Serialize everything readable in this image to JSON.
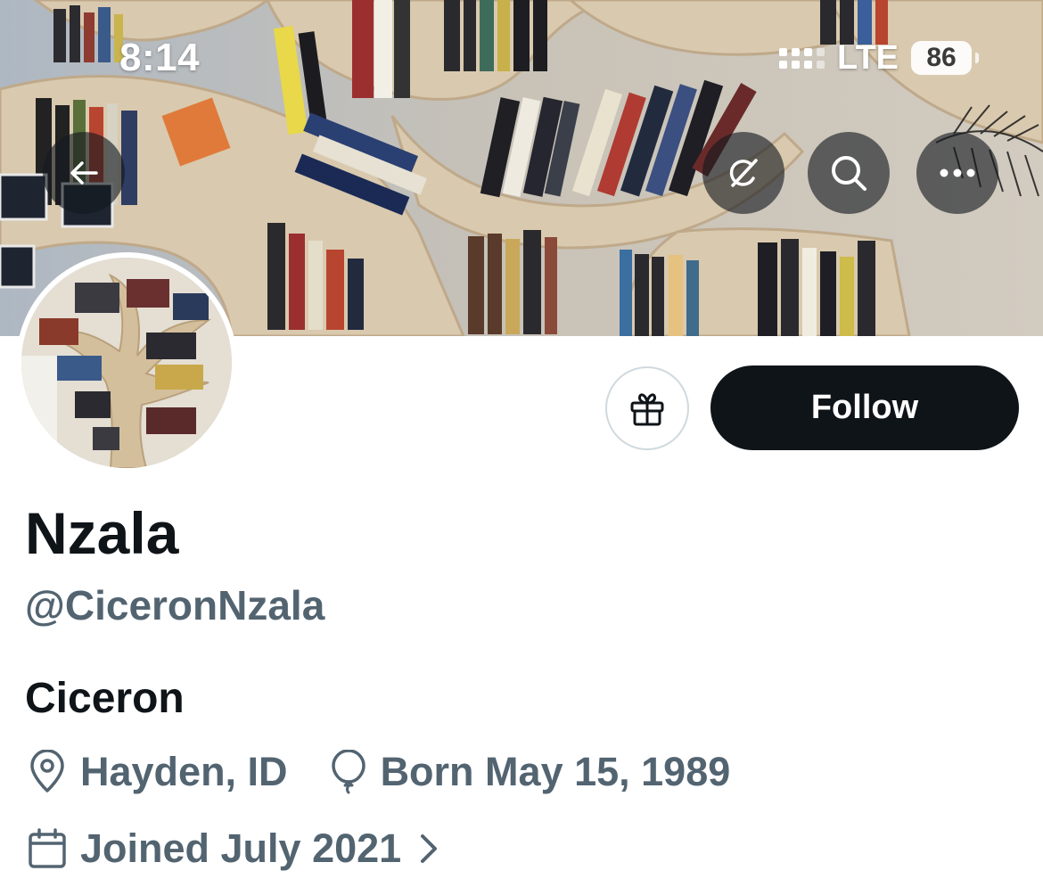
{
  "status_bar": {
    "time": "8:14",
    "network": "LTE",
    "battery": "86"
  },
  "header": {
    "icons": [
      "back-arrow-icon",
      "grok-icon",
      "search-icon",
      "more-icon"
    ]
  },
  "actions": {
    "follow_label": "Follow",
    "gift_icon": "gift-icon"
  },
  "profile": {
    "display_name": "Nzala",
    "handle": "@CiceronNzala",
    "bio": "Ciceron",
    "location": "Hayden, ID",
    "birthday": "Born May 15, 1989",
    "joined": "Joined July 2021"
  },
  "colors": {
    "primary_text": "#0f1419",
    "secondary_text": "#536471",
    "follow_bg": "#0f1419",
    "border": "#cfd9de"
  }
}
